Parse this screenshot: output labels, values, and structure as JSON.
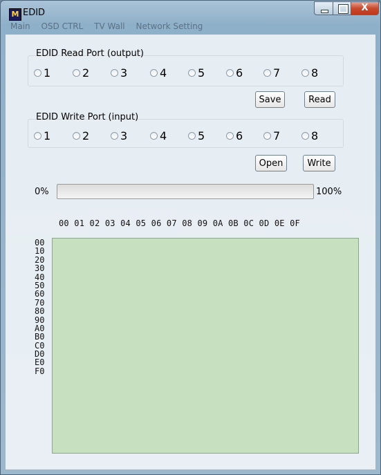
{
  "window": {
    "title": "EDID",
    "app_icon_letter": "M",
    "close_glyph": "X"
  },
  "ghost_tabs": [
    "Main",
    "OSD CTRL",
    "TV Wall",
    "Network Setting"
  ],
  "read_port": {
    "label": "EDID Read Port (output)",
    "options": [
      "1",
      "2",
      "3",
      "4",
      "5",
      "6",
      "7",
      "8"
    ],
    "save_label": "Save",
    "read_label": "Read"
  },
  "write_port": {
    "label": "EDID Write Port (input)",
    "options": [
      "1",
      "2",
      "3",
      "4",
      "5",
      "6",
      "7",
      "8"
    ],
    "open_label": "Open",
    "write_label": "Write"
  },
  "progress": {
    "min_label": "0%",
    "max_label": "100%",
    "value": 0
  },
  "hex": {
    "columns": "00 01 02 03 04 05 06 07 08 09 0A 0B 0C 0D 0E 0F",
    "rows": [
      "00",
      "10",
      "20",
      "30",
      "40",
      "50",
      "60",
      "70",
      "80",
      "90",
      "A0",
      "B0",
      "C0",
      "D0",
      "E0",
      "F0"
    ]
  },
  "colors": {
    "hex_area_bg": "#c6e0c0",
    "close_button": "#c84a2d"
  }
}
